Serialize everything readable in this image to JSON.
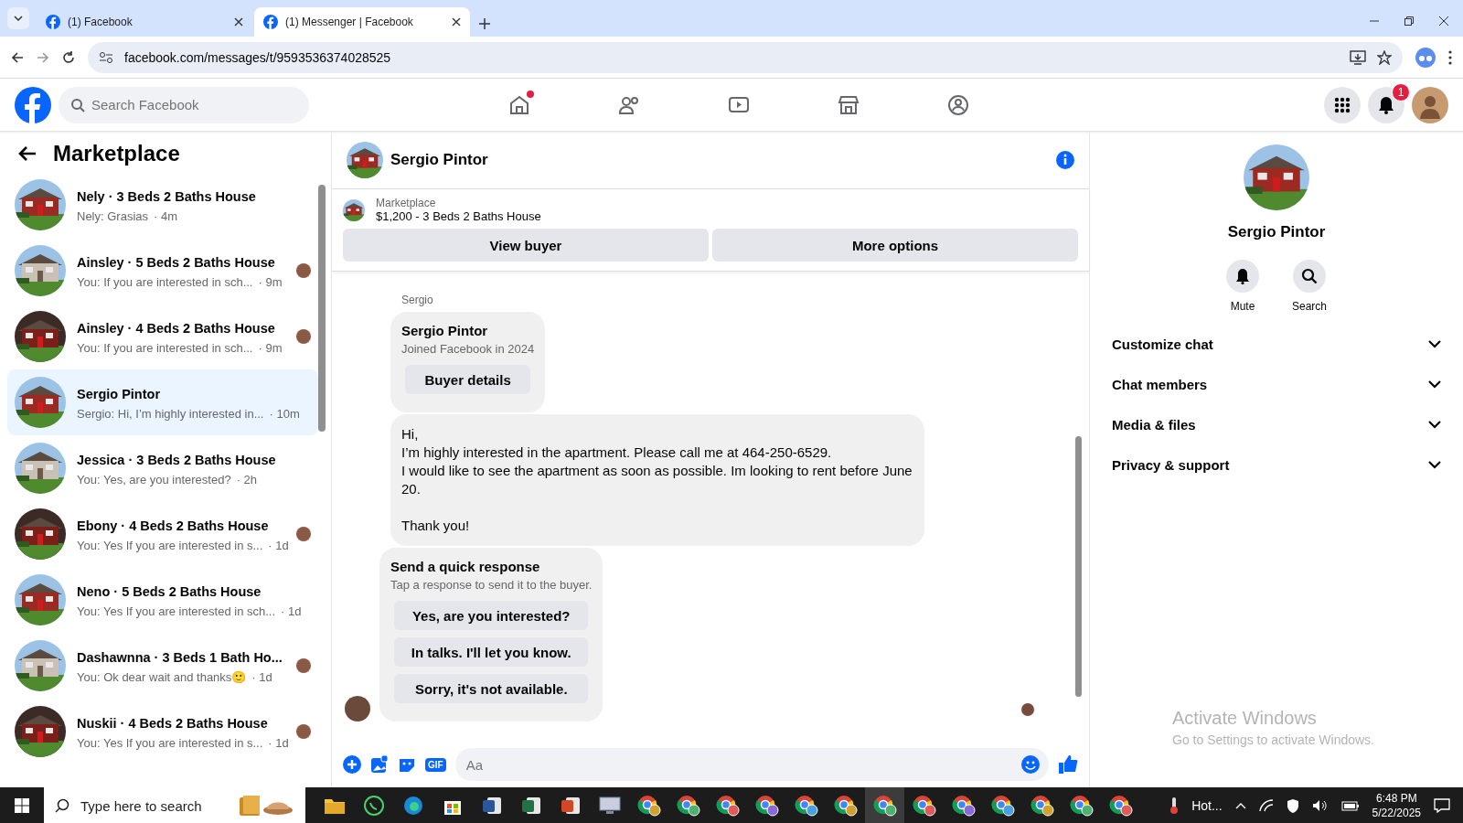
{
  "browser": {
    "tabs": [
      {
        "title": "(1) Facebook",
        "selected": false
      },
      {
        "title": "(1) Messenger | Facebook",
        "selected": true
      }
    ],
    "url": "facebook.com/messages/t/9593536374028525"
  },
  "header": {
    "search_placeholder": "Search Facebook",
    "nav": [
      {
        "kind": "home",
        "badge": true
      },
      {
        "kind": "friends",
        "badge": false
      },
      {
        "kind": "video",
        "badge": false
      },
      {
        "kind": "marketplace",
        "badge": false
      },
      {
        "kind": "groups",
        "badge": false
      }
    ],
    "notification_count": "1"
  },
  "sidebar": {
    "title": "Marketplace",
    "conversations": [
      {
        "title": "Nely · 3 Beds 2 Baths House",
        "preview": "Nely: Grasias",
        "time": "· 4m",
        "selected": false,
        "seen": false
      },
      {
        "title": "Ainsley · 5 Beds 2 Baths House",
        "preview": "You: If you are interested in sch...",
        "time": "· 9m",
        "selected": false,
        "seen": true
      },
      {
        "title": "Ainsley · 4 Beds 2 Baths House",
        "preview": "You: If you are interested in sch...",
        "time": "· 9m",
        "selected": false,
        "seen": true
      },
      {
        "title": "Sergio Pintor",
        "preview": "Sergio: Hi, I’m highly interested in...",
        "time": "· 10m",
        "selected": true,
        "seen": false
      },
      {
        "title": "Jessica · 3 Beds 2 Baths House",
        "preview": "You: Yes, are you interested?",
        "time": "· 2h",
        "selected": false,
        "seen": false
      },
      {
        "title": "Ebony · 4 Beds 2 Baths House",
        "preview": "You: Yes If you are interested in s...",
        "time": "· 1d",
        "selected": false,
        "seen": true
      },
      {
        "title": "Neno · 5 Beds 2 Baths House",
        "preview": "You: Yes If you are interested in sch...",
        "time": "· 1d",
        "selected": false,
        "seen": false
      },
      {
        "title": "Dashawnna · 3 Beds 1 Bath Ho...",
        "preview": "You: Ok dear wait and thanks🙂",
        "time": "· 1d",
        "selected": false,
        "seen": true
      },
      {
        "title": "Nuskii · 4 Beds 2 Baths House",
        "preview": "You: Yes If you are interested in s...",
        "time": "· 1d",
        "selected": false,
        "seen": true
      }
    ]
  },
  "chat": {
    "name": "Sergio Pintor",
    "listing": {
      "label": "Marketplace",
      "title": "$1,200 - 3 Beds 2 Baths House"
    },
    "listing_buttons": [
      "View buyer",
      "More options"
    ],
    "sender": "Sergio",
    "profile_card": {
      "name": "Sergio Pintor",
      "subtitle": "Joined Facebook in 2024",
      "button": "Buyer details"
    },
    "message": [
      [
        "Hi,",
        "I’m highly interested in the apartment. Please call me at 464-250-6529.",
        "I would like to see the apartment as soon as possible. Im looking to rent before June 20."
      ],
      [
        "Thank you!"
      ]
    ],
    "quick_response": {
      "title": "Send a quick response",
      "subtitle": "Tap a response to send it to the buyer.",
      "options": [
        "Yes, are you interested?",
        "In talks. I'll let you know.",
        "Sorry, it's not available."
      ]
    },
    "composer": {
      "gif_label": "GIF",
      "placeholder": "Aa"
    }
  },
  "details": {
    "name": "Sergio Pintor",
    "actions": [
      {
        "kind": "mute",
        "label": "Mute"
      },
      {
        "kind": "search",
        "label": "Search"
      }
    ],
    "sections": [
      {
        "label": "Customize chat",
        "expanded": false
      },
      {
        "label": "Chat members",
        "expanded": false
      },
      {
        "label": "Media & files",
        "expanded": false
      },
      {
        "label": "Privacy & support",
        "expanded": false
      }
    ]
  },
  "watermark": {
    "title": "Activate Windows",
    "subtitle": "Go to Settings to activate Windows."
  },
  "taskbar": {
    "search_placeholder": "Type here to search",
    "apps": [
      {
        "kind": "folder",
        "selected": false
      },
      {
        "kind": "whatsapp",
        "selected": false
      },
      {
        "kind": "edge",
        "selected": false
      },
      {
        "kind": "store",
        "selected": false
      },
      {
        "kind": "word",
        "selected": false
      },
      {
        "kind": "excel",
        "selected": false
      },
      {
        "kind": "powerpoint",
        "selected": false
      },
      {
        "kind": "remote",
        "selected": false
      },
      {
        "kind": "chrome",
        "selected": false
      },
      {
        "kind": "chrome",
        "selected": false
      },
      {
        "kind": "chrome",
        "selected": false
      },
      {
        "kind": "chrome",
        "selected": false
      },
      {
        "kind": "chrome",
        "selected": false
      },
      {
        "kind": "chrome",
        "selected": false
      },
      {
        "kind": "chrome",
        "selected": true
      },
      {
        "kind": "chrome",
        "selected": false
      },
      {
        "kind": "chrome",
        "selected": false
      },
      {
        "kind": "chrome",
        "selected": false
      },
      {
        "kind": "chrome",
        "selected": false
      },
      {
        "kind": "chrome",
        "selected": false
      },
      {
        "kind": "chrome",
        "selected": false
      }
    ],
    "weather": "Hot...",
    "time": "6:48 PM",
    "date": "5/22/2025"
  }
}
